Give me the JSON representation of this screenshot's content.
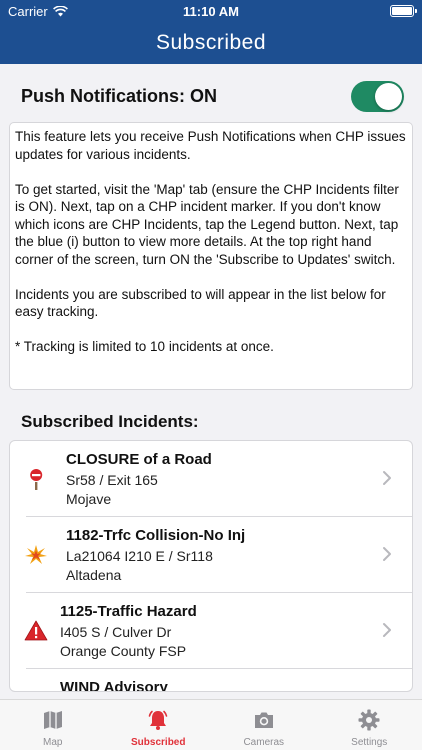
{
  "status_bar": {
    "carrier": "Carrier",
    "time": "11:10 AM"
  },
  "nav": {
    "title": "Subscribed"
  },
  "push": {
    "label": "Push Notifications: ON",
    "enabled": true,
    "toggle_color": "#1f8a63"
  },
  "info": {
    "paragraphs": [
      "This feature lets you receive Push Notifications when CHP issues updates for various incidents.",
      "To get started, visit the 'Map' tab (ensure the CHP Incidents filter is ON). Next, tap on a CHP incident marker. If you don't know which icons are CHP Incidents, tap the Legend button. Next, tap the blue (i) button to view more details. At the top right hand corner of the screen, turn ON the 'Subscribe to Updates' switch.",
      "Incidents you are subscribed to will appear in the list below for easy tracking.",
      "* Tracking is limited to 10 incidents at once."
    ]
  },
  "subscribed": {
    "header": "Subscribed Incidents:",
    "incidents": [
      {
        "title": "CLOSURE of a Road",
        "line1": "Sr58 / Exit 165",
        "line2": "Mojave",
        "icon": "road-closure-icon"
      },
      {
        "title": "1182-Trfc Collision-No Inj",
        "line1": "La21064 I210 E / Sr118",
        "line2": "Altadena",
        "icon": "collision-icon"
      },
      {
        "title": "1125-Traffic Hazard",
        "line1": "I405 S / Culver Dr",
        "line2": "Orange County FSP",
        "icon": "hazard-warning-icon"
      },
      {
        "title": "WIND Advisory",
        "line1": "",
        "line2": "",
        "icon": "wind-advisory-icon"
      }
    ]
  },
  "tabs": [
    {
      "label": "Map",
      "icon": "map-icon",
      "active": false
    },
    {
      "label": "Subscribed",
      "icon": "bell-icon",
      "active": true
    },
    {
      "label": "Cameras",
      "icon": "camera-icon",
      "active": false
    },
    {
      "label": "Settings",
      "icon": "gear-icon",
      "active": false
    }
  ],
  "colors": {
    "nav_blue": "#1d4f91",
    "active_tab": "#e0323a",
    "inactive_tab": "#8e8e93"
  }
}
